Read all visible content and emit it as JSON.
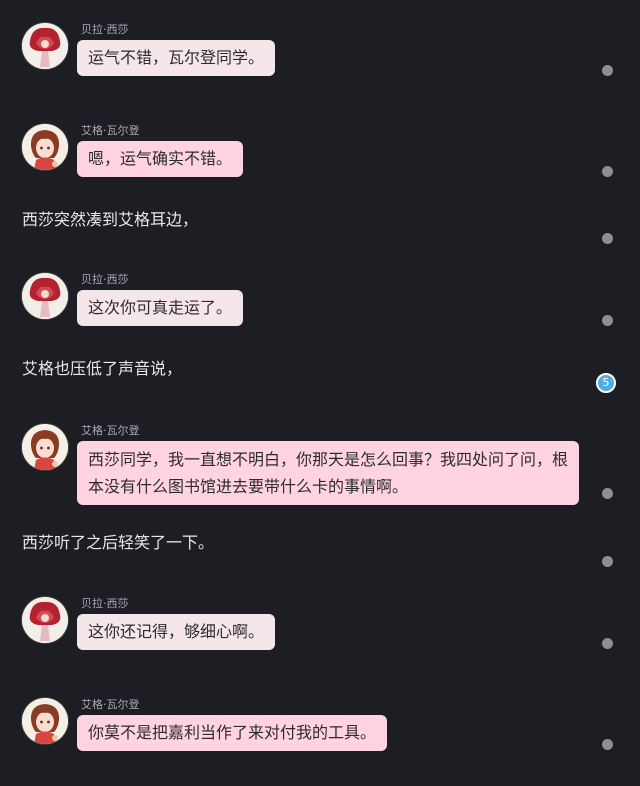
{
  "speakers": {
    "bela": "贝拉·西莎",
    "aige": "艾格·瓦尔登"
  },
  "messages": [
    {
      "speaker": "贝拉·西莎",
      "text": "运气不错，瓦尔登同学。"
    },
    {
      "speaker": "艾格·瓦尔登",
      "text": "嗯，运气确实不错。"
    },
    {
      "narration": "西莎突然凑到艾格耳边，"
    },
    {
      "speaker": "贝拉·西莎",
      "text": "这次你可真走运了。"
    },
    {
      "narration": "艾格也压低了声音说，"
    },
    {
      "speaker": "艾格·瓦尔登",
      "text": "西莎同学，我一直想不明白，你那天是怎么回事？我四处问了问，根本没有什么图书馆进去要带什么卡的事情啊。"
    },
    {
      "narration": "西莎听了之后轻笑了一下。"
    },
    {
      "speaker": "贝拉·西莎",
      "text": "这你还记得，够细心啊。"
    },
    {
      "speaker": "艾格·瓦尔登",
      "text": "你莫不是把嘉利当作了来对付我的工具。"
    }
  ],
  "badge_count": "5",
  "colors": {
    "background": "#1d1e23",
    "bubble_bela": "#f5e6ea",
    "bubble_aige": "#ffd3df",
    "badge": "#4eaee0"
  },
  "icons": {
    "bela_avatar": "avatar-bela-icon",
    "aige_avatar": "avatar-aige-icon",
    "message_dot": "dot-icon"
  }
}
